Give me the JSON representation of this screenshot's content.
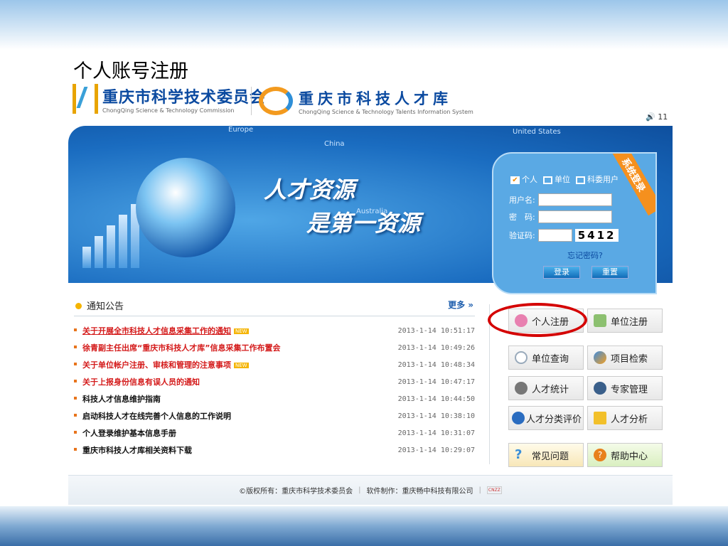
{
  "slide_title": "个人账号注册",
  "header": {
    "logo1_cn": "重庆市科学技术委员会",
    "logo1_en": "ChongQing Science & Technology Commission",
    "logo2_cn": "重庆市科技人才库",
    "logo2_en": "ChongQing Science & Technology Talents Information System",
    "online_count": "11"
  },
  "banner": {
    "slogan_line1": "人才资源",
    "slogan_line2": "是第一资源",
    "map_labels": [
      "China",
      "United States",
      "Australia",
      "Europe"
    ]
  },
  "login": {
    "ribbon": "系统登录",
    "roles": [
      {
        "label": "个人",
        "checked": true
      },
      {
        "label": "单位",
        "checked": false
      },
      {
        "label": "科委用户",
        "checked": false
      }
    ],
    "username_label": "用户名:",
    "password_label": "密　码:",
    "captcha_label": "验证码:",
    "captcha_value": "5412",
    "forgot": "忘记密码?",
    "login_btn": "登录",
    "reset_btn": "重置"
  },
  "notices": {
    "title": "通知公告",
    "more": "更多 »",
    "items": [
      {
        "title": "关于开展全市科技人才信息采集工作的通知",
        "date": "2013-1-14 10:51:17",
        "new": "NEW"
      },
      {
        "title": "徐青副主任出席“重庆市科技人才库”信息采集工作布置会",
        "date": "2013-1-14 10:49:26"
      },
      {
        "title": "关于单位帐户注册、审核和管理的注意事项",
        "date": "2013-1-14 10:48:34",
        "new": "NEW"
      },
      {
        "title": "关于上报身份信息有误人员的通知",
        "date": "2013-1-14 10:47:17"
      },
      {
        "title": "科技人才信息维护指南",
        "date": "2013-1-14 10:44:50"
      },
      {
        "title": "启动科技人才在线完善个人信息的工作说明",
        "date": "2013-1-14 10:38:10"
      },
      {
        "title": "个人登录维护基本信息手册",
        "date": "2013-1-14 10:31:07"
      },
      {
        "title": "重庆市科技人才库相关资料下载",
        "date": "2013-1-14 10:29:07"
      }
    ]
  },
  "quick": {
    "personal_reg": "个人注册",
    "unit_reg": "单位注册",
    "unit_query": "单位查询",
    "project_search": "项目检索",
    "talent_stats": "人才统计",
    "expert_mgmt": "专家管理",
    "talent_eval": "人才分类评价",
    "talent_analysis": "人才分析",
    "faq": "常见问题",
    "help": "帮助中心"
  },
  "footer": {
    "copyright": "©版权所有：重庆市科学技术委员会",
    "sep": "|",
    "maker": "软件制作：重庆畅中科技有限公司",
    "cnzz": "CNZZ"
  },
  "colors": {
    "highlight_circle": "#d40000",
    "notice_red": "#d41a1a",
    "brand_blue": "#0b4aa0"
  }
}
